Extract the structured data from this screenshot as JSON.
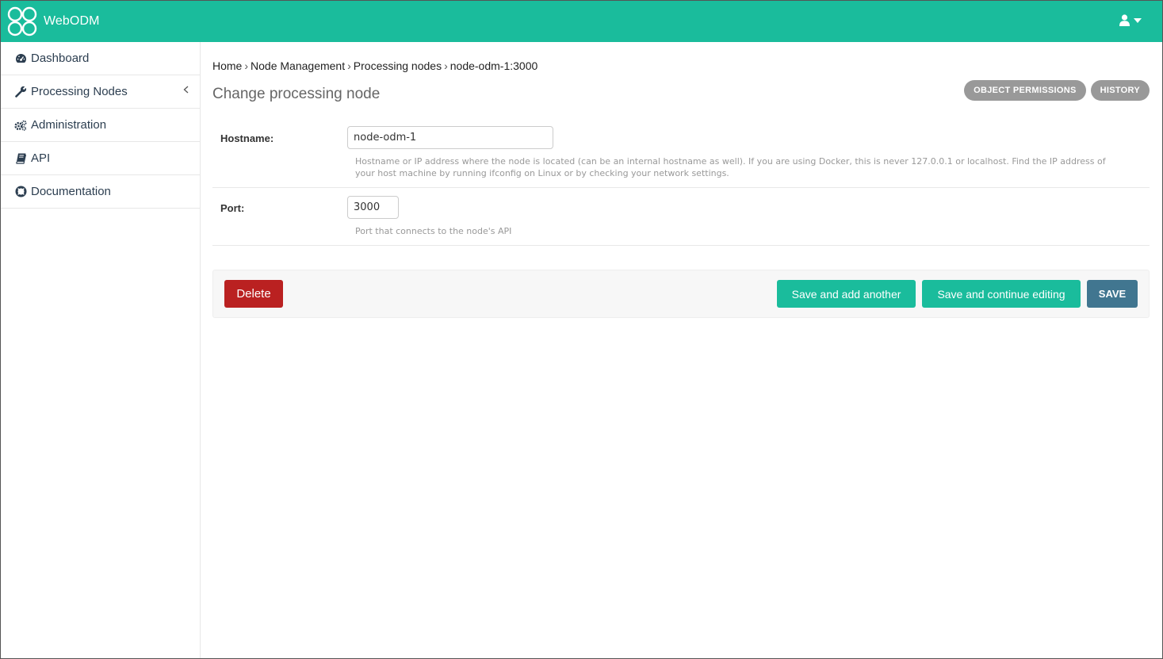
{
  "header": {
    "brand": "WebODM",
    "accent_color": "#1abc9c",
    "logo_icon": "webodm-logo-icon",
    "user_icon": "user-icon",
    "caret_icon": "caret-down-icon"
  },
  "sidebar": {
    "items": [
      {
        "label": "Dashboard",
        "icon": "dashboard-icon"
      },
      {
        "label": "Processing Nodes",
        "icon": "wrench-icon",
        "expandable": true
      },
      {
        "label": "Administration",
        "icon": "cogs-icon"
      },
      {
        "label": "API",
        "icon": "book-icon"
      },
      {
        "label": "Documentation",
        "icon": "life-ring-icon"
      }
    ]
  },
  "breadcrumb": {
    "home": "Home",
    "section": "Node Management",
    "model": "Processing nodes",
    "current": "node-odm-1:3000",
    "separator": "›"
  },
  "page": {
    "title": "Change processing node",
    "object_tools": [
      "OBJECT PERMISSIONS",
      "HISTORY"
    ]
  },
  "form": {
    "hostname": {
      "label": "Hostname:",
      "value": "node-odm-1",
      "help_line1": "Hostname or IP address where the node is located (can be an internal hostname as well). If you are using Docker, this is never 127.0.0.1 or localhost. Find the IP address of",
      "help_line2": "your host machine by running ifconfig on Linux or by checking your network settings."
    },
    "port": {
      "label": "Port:",
      "value": "3000",
      "help": "Port that connects to the node's API"
    }
  },
  "actions": {
    "delete": "Delete",
    "save_add": "Save and add another",
    "save_continue": "Save and continue editing",
    "save": "SAVE",
    "colors": {
      "delete": "#ba2121",
      "primary": "#1abc9c",
      "save": "#417690"
    }
  }
}
